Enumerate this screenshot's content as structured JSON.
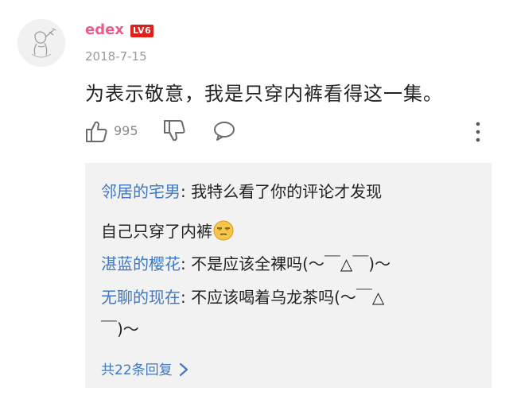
{
  "comment": {
    "username": "edex",
    "level_badge": "LV6",
    "date": "2018-7-15",
    "text": "为表示敬意，我是只穿内裤看得这一集。",
    "like_count": "995"
  },
  "replies": [
    {
      "user": "邻居的宅男",
      "text": "我特么看了你的评论才发现"
    },
    {
      "continuation": "自己只穿了内裤"
    },
    {
      "user": "湛蓝的樱花",
      "text": "不是应该全裸吗(〜￣△￣)〜"
    },
    {
      "user": "无聊的现在",
      "text": "不应该喝着乌龙茶吗(〜￣△"
    },
    {
      "continuation": "￣)〜"
    }
  ],
  "see_all_label": "共22条回复",
  "icons": {
    "like": "thumbs-up-icon",
    "dislike": "thumbs-down-icon",
    "reply": "speech-bubble-icon",
    "more": "vertical-dots-icon",
    "emoji": "smirk-face-icon",
    "see_all": "chevron-right-icon"
  },
  "colors": {
    "username": "#e85d8c",
    "level_badge": "#e0201c",
    "reply_user": "#3f78c2",
    "replies_background": "#f2f2f2"
  }
}
